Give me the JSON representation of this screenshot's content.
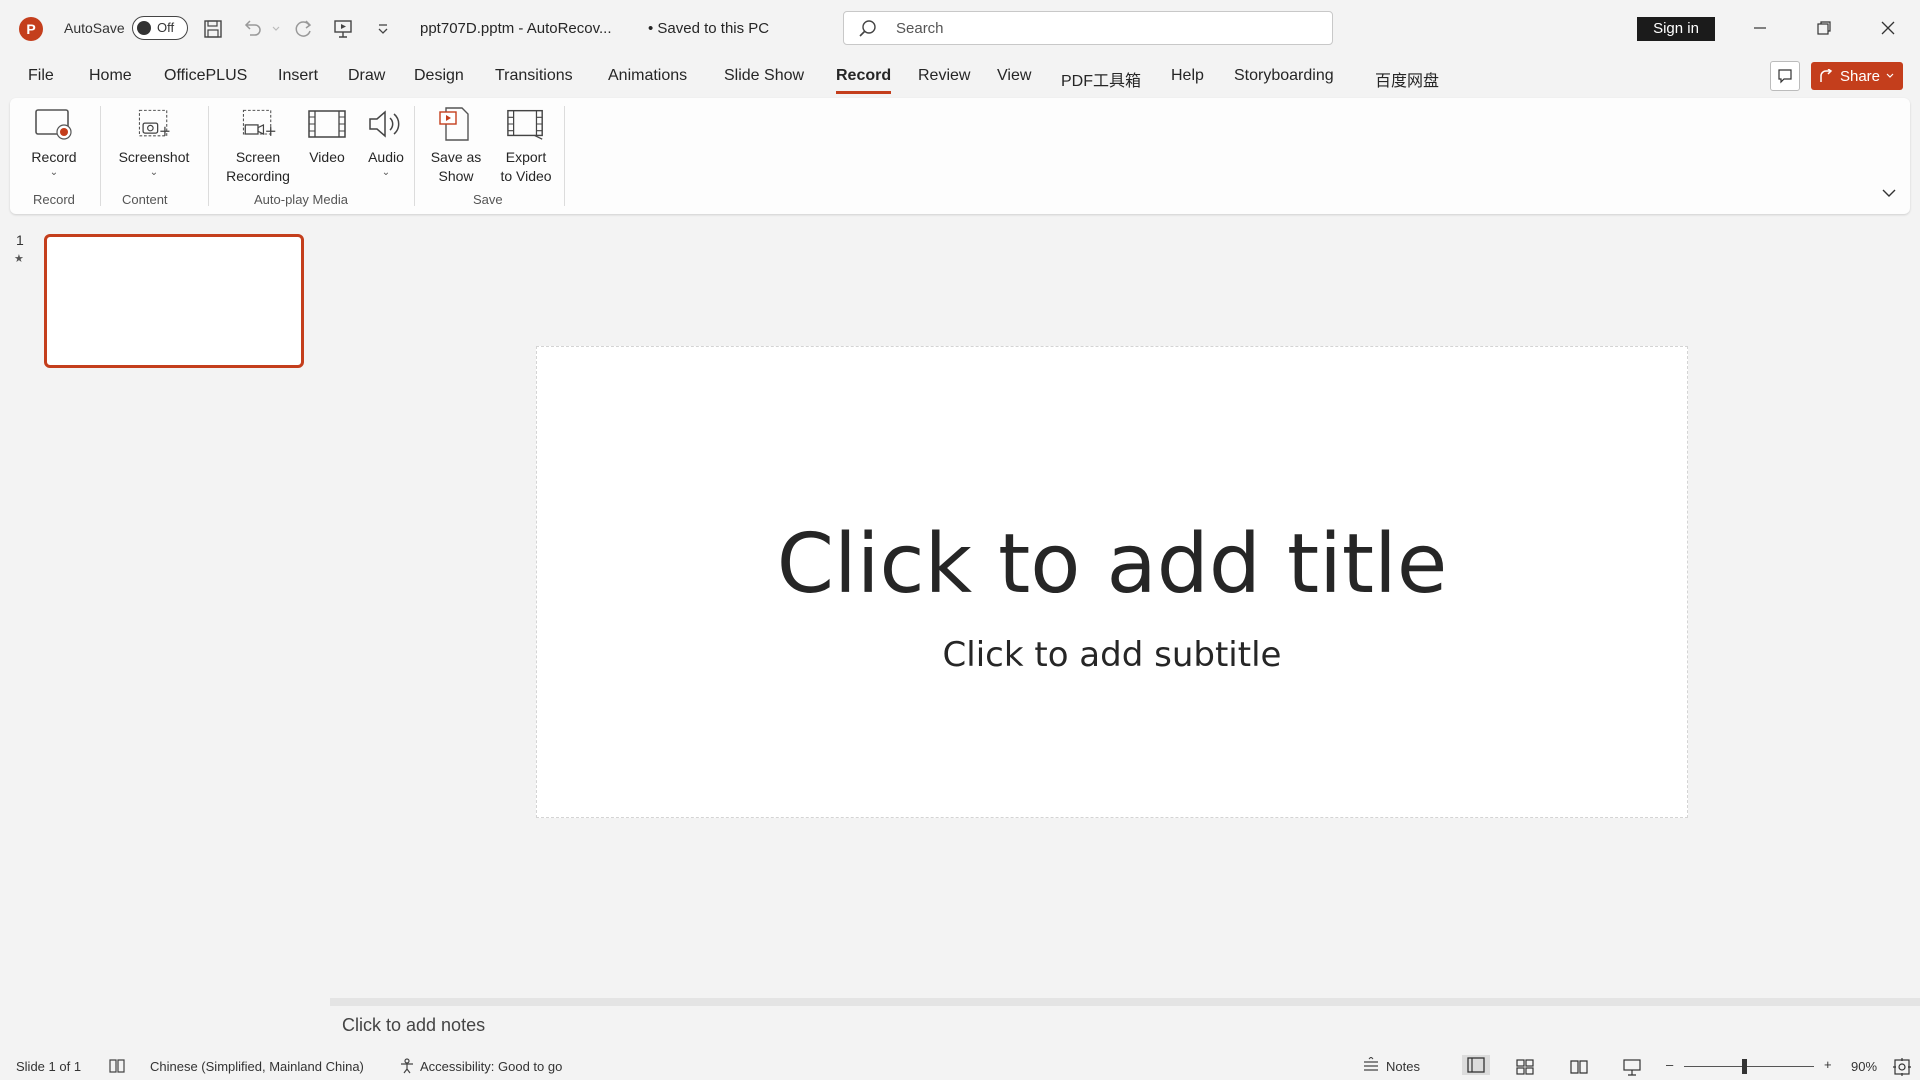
{
  "titlebar": {
    "app_letter": "P",
    "autosave_label": "AutoSave",
    "autosave_state": "Off",
    "document_title": "ppt707D.pptm  -  AutoRecov...",
    "save_status": "• Saved to this PC",
    "search_placeholder": "Search",
    "sign_in_label": "Sign in"
  },
  "tabs": [
    "File",
    "Home",
    "OfficePLUS",
    "Insert",
    "Draw",
    "Design",
    "Transitions",
    "Animations",
    "Slide Show",
    "Record",
    "Review",
    "View",
    "PDF工具箱",
    "Help",
    "Storyboarding",
    "百度网盘"
  ],
  "active_tab": "Record",
  "share_label": "Share",
  "ribbon": {
    "buttons": {
      "record": "Record",
      "screenshot": "Screenshot",
      "screen_recording_1": "Screen",
      "screen_recording_2": "Recording",
      "video": "Video",
      "audio": "Audio",
      "save_as_show_1": "Save as",
      "save_as_show_2": "Show",
      "export_video_1": "Export",
      "export_video_2": "to Video"
    },
    "groups": {
      "record": "Record",
      "content": "Content",
      "auto_play_media": "Auto-play Media",
      "save": "Save"
    }
  },
  "slides_panel": {
    "slide_number": "1",
    "star": "★"
  },
  "slide": {
    "title_placeholder": "Click to add title",
    "subtitle_placeholder": "Click to add subtitle"
  },
  "notes_placeholder": "Click to add notes",
  "statusbar": {
    "slide_counter": "Slide 1 of 1",
    "language": "Chinese (Simplified, Mainland China)",
    "accessibility": "Accessibility: Good to go",
    "notes_label": "Notes",
    "zoom_level": "90%",
    "zoom_minus": "–",
    "zoom_plus": "+"
  },
  "colors": {
    "accent": "#c43e1c",
    "background": "#f3f3f3",
    "slide": "#ffffff"
  }
}
